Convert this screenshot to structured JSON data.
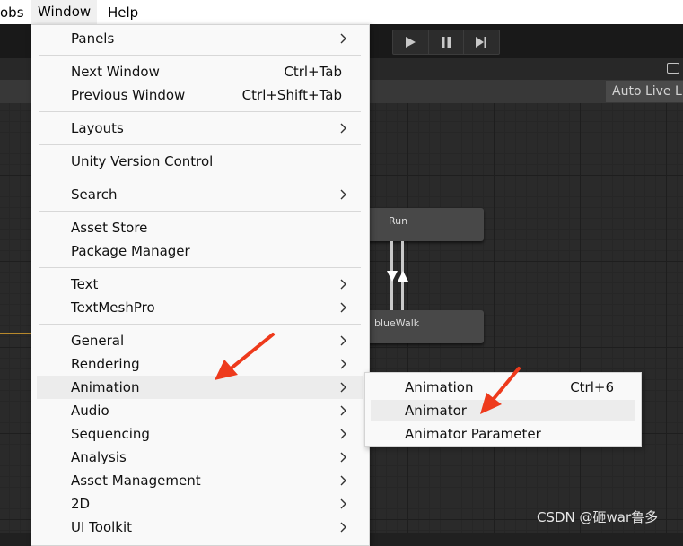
{
  "menubar": {
    "items": [
      {
        "label": "obs"
      },
      {
        "label": "Window"
      },
      {
        "label": "Help"
      }
    ]
  },
  "toolbar": {
    "play_icon": "play-icon",
    "pause_icon": "pause-icon",
    "step_icon": "step-icon"
  },
  "animator": {
    "auto_live_label": "Auto Live L",
    "states": [
      {
        "label": "Run"
      },
      {
        "label": "blueWalk"
      }
    ],
    "accent_color": "#b8892c"
  },
  "window_menu": {
    "items": [
      {
        "label": "Panels",
        "shortcut": "",
        "submenu": true
      },
      {
        "label": "Next Window",
        "shortcut": "Ctrl+Tab",
        "submenu": false
      },
      {
        "label": "Previous Window",
        "shortcut": "Ctrl+Shift+Tab",
        "submenu": false
      },
      {
        "label": "Layouts",
        "shortcut": "",
        "submenu": true
      },
      {
        "label": "Unity Version Control",
        "shortcut": "",
        "submenu": false
      },
      {
        "label": "Search",
        "shortcut": "",
        "submenu": true
      },
      {
        "label": "Asset Store",
        "shortcut": "",
        "submenu": false
      },
      {
        "label": "Package Manager",
        "shortcut": "",
        "submenu": false
      },
      {
        "label": "Text",
        "shortcut": "",
        "submenu": true
      },
      {
        "label": "TextMeshPro",
        "shortcut": "",
        "submenu": true
      },
      {
        "label": "General",
        "shortcut": "",
        "submenu": true
      },
      {
        "label": "Rendering",
        "shortcut": "",
        "submenu": true
      },
      {
        "label": "Animation",
        "shortcut": "",
        "submenu": true
      },
      {
        "label": "Audio",
        "shortcut": "",
        "submenu": true
      },
      {
        "label": "Sequencing",
        "shortcut": "",
        "submenu": true
      },
      {
        "label": "Analysis",
        "shortcut": "",
        "submenu": true
      },
      {
        "label": "Asset Management",
        "shortcut": "",
        "submenu": true
      },
      {
        "label": "2D",
        "shortcut": "",
        "submenu": true
      },
      {
        "label": "UI Toolkit",
        "shortcut": "",
        "submenu": true
      }
    ]
  },
  "animation_submenu": {
    "items": [
      {
        "label": "Animation",
        "shortcut": "Ctrl+6"
      },
      {
        "label": "Animator",
        "shortcut": ""
      },
      {
        "label": "Animator Parameter",
        "shortcut": ""
      }
    ]
  },
  "annotation": {
    "arrow_color": "#ee3a1c"
  },
  "watermark": {
    "text": "CSDN @砸war鲁多"
  }
}
